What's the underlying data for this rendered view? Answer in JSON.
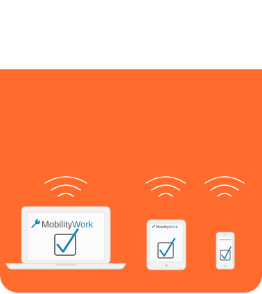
{
  "colors": {
    "background": "#fe6b2c",
    "wifi": "#ffffff",
    "device_frame": "#f2f2f2",
    "screen": "#fbfbfb",
    "check": "#1b7fb8",
    "brand_dark": "#4d4d4d",
    "brand_blue": "#1b7fb8"
  },
  "brand": {
    "name_part1": "Mobility",
    "name_part2": "Work",
    "logo_icon": "wrench-icon"
  },
  "devices": [
    {
      "kind": "laptop",
      "icon": "laptop-icon",
      "wifi": "wifi-icon"
    },
    {
      "kind": "tablet",
      "icon": "tablet-icon",
      "wifi": "wifi-icon"
    },
    {
      "kind": "phone",
      "icon": "phone-icon",
      "wifi": "wifi-icon"
    }
  ]
}
